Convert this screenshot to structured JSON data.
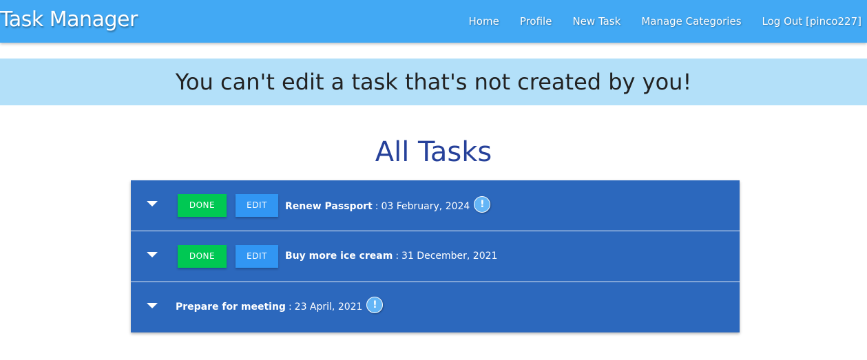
{
  "navbar": {
    "brand": "Task Manager",
    "links": [
      "Home",
      "Profile",
      "New Task",
      "Manage Categories",
      "Log Out [pinco227]"
    ]
  },
  "flash_message": "You can't edit a task that's not created by you!",
  "page_title": "All Tasks",
  "tasks": [
    {
      "name": "Renew Passport",
      "separator": ":",
      "date": "03 February, 2024",
      "done_label": "DONE",
      "edit_label": "EDIT",
      "has_alert_icon": true
    },
    {
      "name": "Buy more ice cream",
      "separator": ":",
      "date": "31 December, 2021",
      "done_label": "DONE",
      "edit_label": "EDIT",
      "has_alert_icon": false
    },
    {
      "name": "Prepare for meeting",
      "separator": ":",
      "date": "23 April, 2021",
      "has_alert_icon": true
    }
  ],
  "icons": {
    "expand": "caret-down-icon",
    "alert": "exclamation-circle-icon",
    "alert_glyph": "!"
  },
  "colors": {
    "navbar": "#42a9f4",
    "flash_background": "#b3e0f9",
    "task_list_background": "#2c68bd",
    "done_button": "#00c853",
    "edit_button": "#3196f3",
    "title": "#26419a"
  }
}
